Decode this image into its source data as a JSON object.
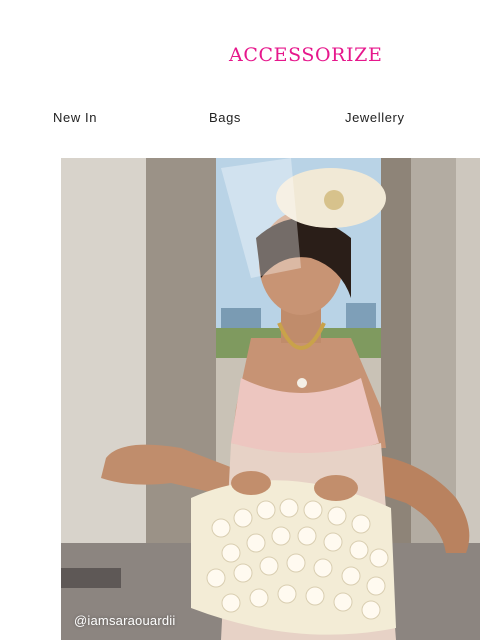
{
  "brand": {
    "name": "ACCESSORIZE",
    "color": "#e6178c"
  },
  "nav": {
    "items": [
      {
        "label": "New In"
      },
      {
        "label": "Bags"
      },
      {
        "label": "Jewellery"
      }
    ]
  },
  "hero": {
    "credit": "@iamsaraouardii"
  }
}
